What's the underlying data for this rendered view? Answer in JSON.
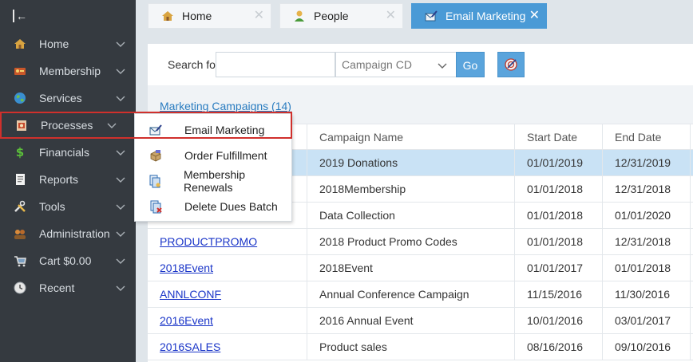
{
  "sidebar": {
    "items": [
      {
        "label": "Home",
        "icon": "home-icon"
      },
      {
        "label": "Membership",
        "icon": "membership-icon"
      },
      {
        "label": "Services",
        "icon": "globe-icon"
      },
      {
        "label": "Processes",
        "icon": "processes-icon"
      },
      {
        "label": "Financials",
        "icon": "money-icon"
      },
      {
        "label": "Reports",
        "icon": "report-icon"
      },
      {
        "label": "Tools",
        "icon": "tools-icon"
      },
      {
        "label": "Administration",
        "icon": "admin-icon"
      },
      {
        "label": "Cart $0.00",
        "icon": "cart-icon"
      },
      {
        "label": "Recent",
        "icon": "clock-icon"
      }
    ]
  },
  "tabs": [
    {
      "label": "Home",
      "icon": "home-icon"
    },
    {
      "label": "People",
      "icon": "person-icon"
    },
    {
      "label": "Email Marketing",
      "icon": "email-marketing-icon",
      "active": true
    }
  ],
  "search": {
    "label": "Search for:",
    "value": "",
    "selected_option": "Campaign CD",
    "go_label": "Go"
  },
  "section": {
    "title": "Marketing Campaigns (14)"
  },
  "table": {
    "headers": [
      "Campaign Name",
      "Start Date",
      "End Date"
    ],
    "rows": [
      {
        "code": "",
        "name": "2019 Donations",
        "start": "01/01/2019",
        "end": "12/31/2019"
      },
      {
        "code": "",
        "name": "2018Membership",
        "start": "01/01/2018",
        "end": "12/31/2018"
      },
      {
        "code": "",
        "name": "Data Collection",
        "start": "01/01/2018",
        "end": "01/01/2020"
      },
      {
        "code": "PRODUCTPROMO",
        "name": "2018 Product Promo Codes",
        "start": "01/01/2018",
        "end": "12/31/2018"
      },
      {
        "code": "2018Event",
        "name": "2018Event",
        "start": "01/01/2017",
        "end": "01/01/2018"
      },
      {
        "code": "ANNLCONF",
        "name": "Annual Conference Campaign",
        "start": "11/15/2016",
        "end": "11/30/2016"
      },
      {
        "code": "2016Event",
        "name": "2016 Annual Event",
        "start": "10/01/2016",
        "end": "03/01/2017"
      },
      {
        "code": "2016SALES",
        "name": "Product sales",
        "start": "08/16/2016",
        "end": "09/10/2016"
      }
    ]
  },
  "flyout": {
    "items": [
      {
        "label": "Email Marketing",
        "icon": "email-marketing-icon"
      },
      {
        "label": "Order Fulfillment",
        "icon": "package-icon"
      },
      {
        "label": "Membership Renewals",
        "icon": "renewal-icon"
      },
      {
        "label": "Delete Dues Batch",
        "icon": "delete-batch-icon"
      }
    ]
  },
  "colors": {
    "sidebar_bg": "#353a40",
    "accent": "#4a9ad6",
    "highlight_border": "#d0302c",
    "selected_row": "#c9e2f5"
  }
}
